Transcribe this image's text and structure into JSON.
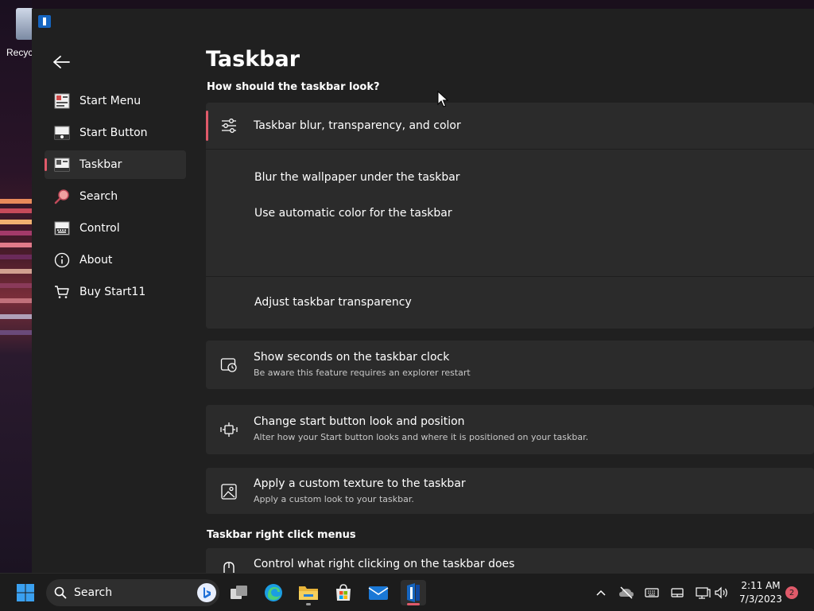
{
  "desktop": {
    "recycle_label": "Recyc"
  },
  "page": {
    "title": "Taskbar"
  },
  "sidebar": {
    "items": [
      {
        "label": "Start Menu",
        "icon": "start-menu-icon"
      },
      {
        "label": "Start Button",
        "icon": "start-button-icon"
      },
      {
        "label": "Taskbar",
        "icon": "taskbar-icon",
        "active": true
      },
      {
        "label": "Search",
        "icon": "search-icon"
      },
      {
        "label": "Control",
        "icon": "keyboard-icon"
      },
      {
        "label": "About",
        "icon": "info-icon"
      },
      {
        "label": "Buy Start11",
        "icon": "cart-icon"
      }
    ]
  },
  "sections": {
    "look_heading": "How should the taskbar look?",
    "right_click_heading": "Taskbar right click menus"
  },
  "blur_panel": {
    "title": "Taskbar blur, transparency, and color",
    "blur_label": "Blur the wallpaper under the taskbar",
    "auto_color_label": "Use automatic color for the taskbar",
    "transparency_label": "Adjust taskbar transparency"
  },
  "cards": [
    {
      "title": "Show seconds on the taskbar clock",
      "desc": "Be aware this feature requires an explorer restart",
      "icon": "clock-icon"
    },
    {
      "title": "Change start button look and position",
      "desc": "Alter how your Start button looks and where it is positioned on your taskbar.",
      "icon": "position-icon"
    },
    {
      "title": "Apply a custom texture to the taskbar",
      "desc": "Apply a custom look to your taskbar.",
      "icon": "image-icon"
    },
    {
      "title": "Control what right clicking on the taskbar does",
      "desc": "",
      "icon": "mouse-icon"
    }
  ],
  "taskbar": {
    "search_label": "Search",
    "time": "2:11 AM",
    "date": "7/3/2023",
    "notification_count": "2"
  },
  "colors": {
    "accent": "#e05a6a",
    "panel": "#2b2b2b",
    "window": "#202020"
  }
}
